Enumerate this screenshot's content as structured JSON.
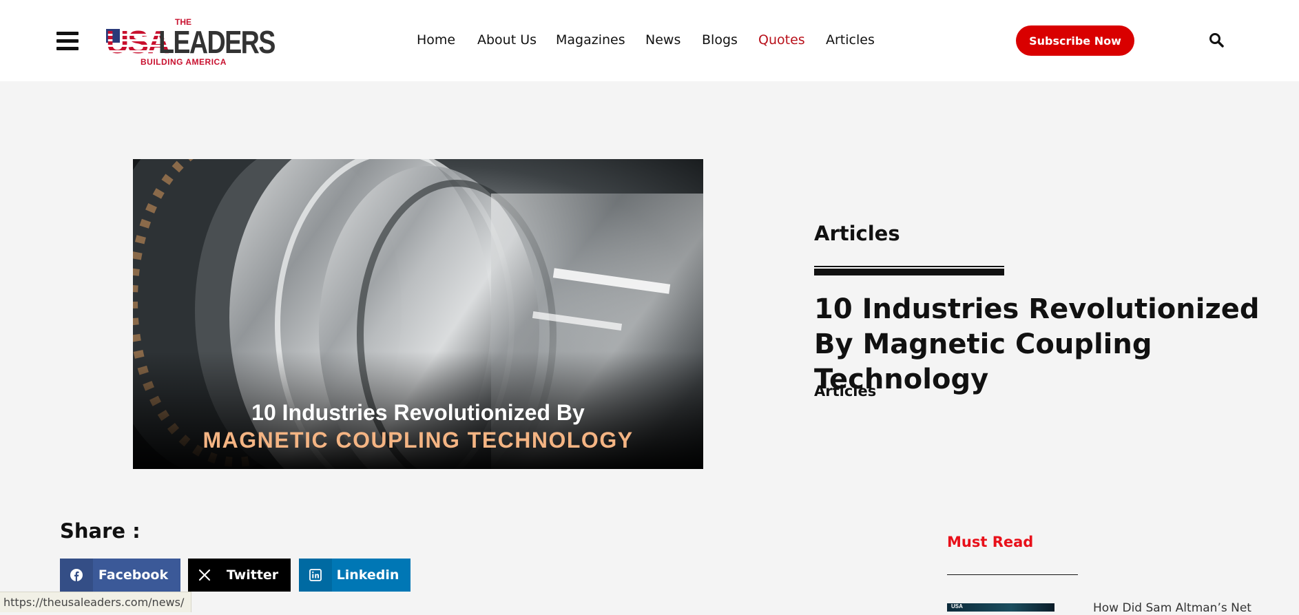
{
  "header": {
    "logo": {
      "the": "THE",
      "usa": "USA",
      "leaders": "LEADERS",
      "tagline": "BUILDING AMERICA"
    },
    "nav": [
      {
        "label": "Home",
        "active": false
      },
      {
        "label": "About Us",
        "active": false
      },
      {
        "label": "Magazines",
        "active": false
      },
      {
        "label": "News",
        "active": false
      },
      {
        "label": "Blogs",
        "active": false
      },
      {
        "label": "Quotes",
        "active": true
      },
      {
        "label": "Articles",
        "active": false
      }
    ],
    "subscribe_label": "Subscribe Now",
    "icons": {
      "menu": "hamburger-menu-icon",
      "search": "search-icon"
    }
  },
  "hero": {
    "image_caption_line1": "10 Industries Revolutionized By",
    "image_caption_line2": "MAGNETIC COUPLING TECHNOLOGY",
    "category_heading": "Articles",
    "title": "10 Industries Revolutionized By Magnetic Coupling Technology",
    "category_link": "Articles"
  },
  "share": {
    "label": "Share :",
    "buttons": [
      {
        "label": "Facebook",
        "icon": "facebook-icon"
      },
      {
        "label": "Twitter",
        "icon": "x-icon"
      },
      {
        "label": "Linkedin",
        "icon": "linkedin-icon"
      }
    ]
  },
  "must_read": {
    "heading": "Must Read",
    "items": [
      {
        "thumb_text": "USA",
        "title": "How Did Sam Altman’s Net"
      }
    ]
  },
  "status_bar": {
    "url": "https://theusaleaders.com/news/"
  },
  "colors": {
    "accent_red": "#d90000",
    "active_nav": "#b8101a",
    "must_read_red": "#e8101a",
    "facebook": "#3b5998",
    "twitter": "#000000",
    "linkedin": "#0077b5",
    "caption_orange": "#f4b483"
  }
}
